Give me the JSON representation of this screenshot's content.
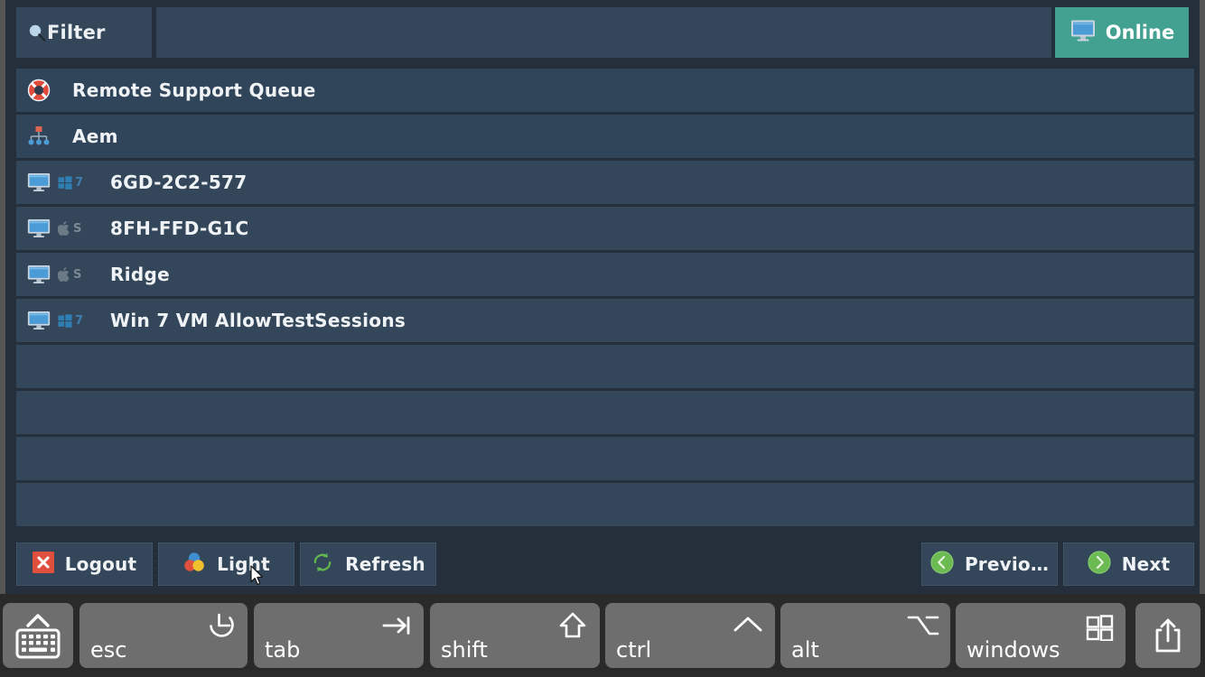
{
  "app": {
    "background_color": "#242f3b",
    "row_color": "#34475a",
    "accent_online": "#42a190"
  },
  "topbar": {
    "filter_button_label": "Filter",
    "filter_icon": "search-icon",
    "filter_input_value": "",
    "filter_input_placeholder": "",
    "status_button_label": "Online",
    "status_icon": "monitor-icon"
  },
  "list": {
    "rows": [
      {
        "type": "group",
        "label": "Remote Support Queue",
        "icon": "lifebuoy-icon"
      },
      {
        "type": "group",
        "label": "Aem",
        "icon": "network-tree-icon"
      },
      {
        "type": "machine",
        "label": "6GD-2C2-577",
        "icon": "monitor-icon",
        "os": "windows",
        "os_version": "7"
      },
      {
        "type": "machine",
        "label": "8FH-FFD-G1C",
        "icon": "monitor-icon",
        "os": "apple",
        "os_version": "S"
      },
      {
        "type": "machine",
        "label": "Ridge",
        "icon": "monitor-icon",
        "os": "apple",
        "os_version": "S"
      },
      {
        "type": "machine",
        "label": "Win 7 VM AllowTestSessions",
        "icon": "monitor-icon",
        "os": "windows",
        "os_version": "7"
      },
      {
        "type": "empty",
        "label": ""
      },
      {
        "type": "empty",
        "label": ""
      },
      {
        "type": "empty",
        "label": ""
      },
      {
        "type": "empty",
        "label": ""
      }
    ]
  },
  "toolbar": {
    "logout_label": "Logout",
    "logout_icon": "red-x-icon",
    "light_label": "Light",
    "light_icon": "color-circles-icon",
    "refresh_label": "Refresh",
    "refresh_icon": "refresh-icon",
    "previous_label": "Previo…",
    "previous_icon": "chevron-left-circle-icon",
    "next_label": "Next",
    "next_icon": "chevron-right-circle-icon"
  },
  "keyboard_bar": {
    "keys": [
      {
        "name": "keyboard-toggle",
        "label": "",
        "glyph": "keyboard-up-icon"
      },
      {
        "name": "esc",
        "label": "esc",
        "glyph": "escape-arrow-icon"
      },
      {
        "name": "tab",
        "label": "tab",
        "glyph": "tab-arrow-icon"
      },
      {
        "name": "shift",
        "label": "shift",
        "glyph": "shift-arrow-icon"
      },
      {
        "name": "ctrl",
        "label": "ctrl",
        "glyph": "control-caret-icon"
      },
      {
        "name": "alt",
        "label": "alt",
        "glyph": "option-alt-icon"
      },
      {
        "name": "windows",
        "label": "windows",
        "glyph": "windows-logo-icon"
      },
      {
        "name": "share",
        "label": "",
        "glyph": "share-export-icon"
      }
    ]
  }
}
